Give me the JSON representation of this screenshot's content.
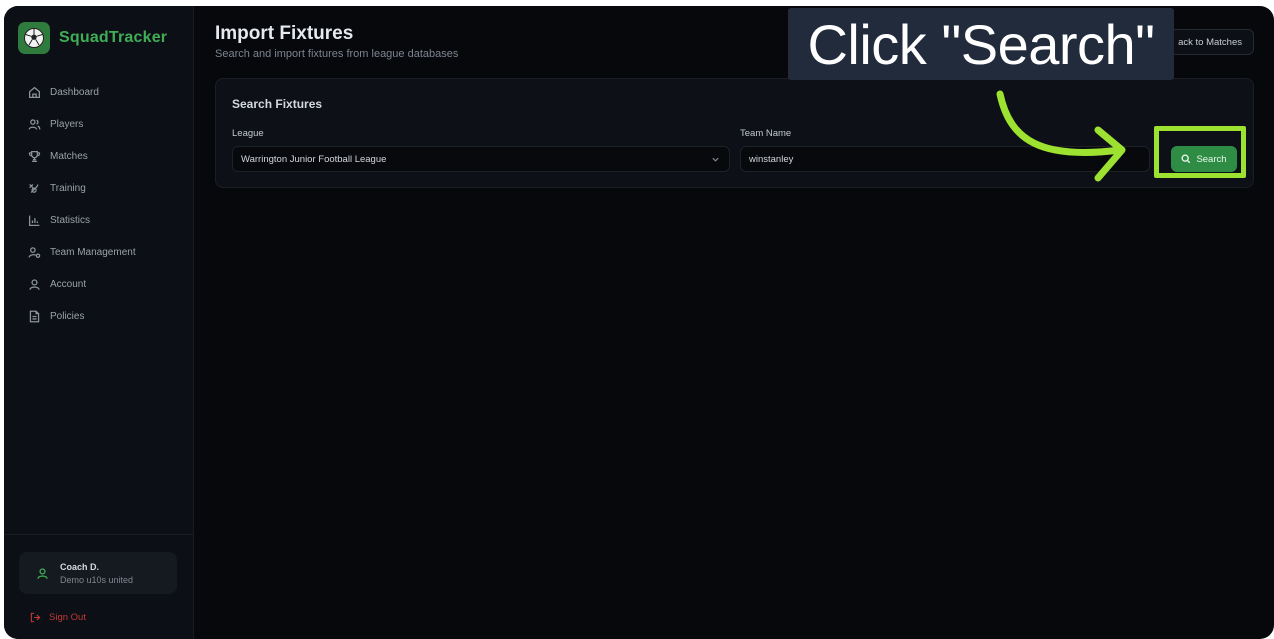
{
  "brand": {
    "name": "SquadTracker",
    "logo_icon": "soccer-ball-icon"
  },
  "sidebar": {
    "items": [
      {
        "label": "Dashboard",
        "icon": "home-icon"
      },
      {
        "label": "Players",
        "icon": "users-icon"
      },
      {
        "label": "Matches",
        "icon": "trophy-icon"
      },
      {
        "label": "Training",
        "icon": "training-icon"
      },
      {
        "label": "Statistics",
        "icon": "chart-icon"
      },
      {
        "label": "Team Management",
        "icon": "user-cog-icon"
      },
      {
        "label": "Account",
        "icon": "user-icon"
      },
      {
        "label": "Policies",
        "icon": "document-icon"
      }
    ],
    "user": {
      "name": "Coach D.",
      "team": "Demo u10s united"
    },
    "signout_label": "Sign Out"
  },
  "page": {
    "title": "Import Fixtures",
    "subtitle": "Search and import fixtures from league databases",
    "back_button_label": "ack to Matches"
  },
  "search_card": {
    "title": "Search Fixtures",
    "league_label": "League",
    "league_value": "Warrington Junior Football League",
    "team_label": "Team Name",
    "team_value": "winstanley",
    "search_button_label": "Search"
  },
  "overlay": {
    "callout_text": "Click \"Search\"",
    "highlight_color": "#9ee231"
  },
  "colors": {
    "accent_green": "#3fae55",
    "button_green": "#2f8c45",
    "signout_red": "#c23838",
    "background": "#06080c"
  }
}
